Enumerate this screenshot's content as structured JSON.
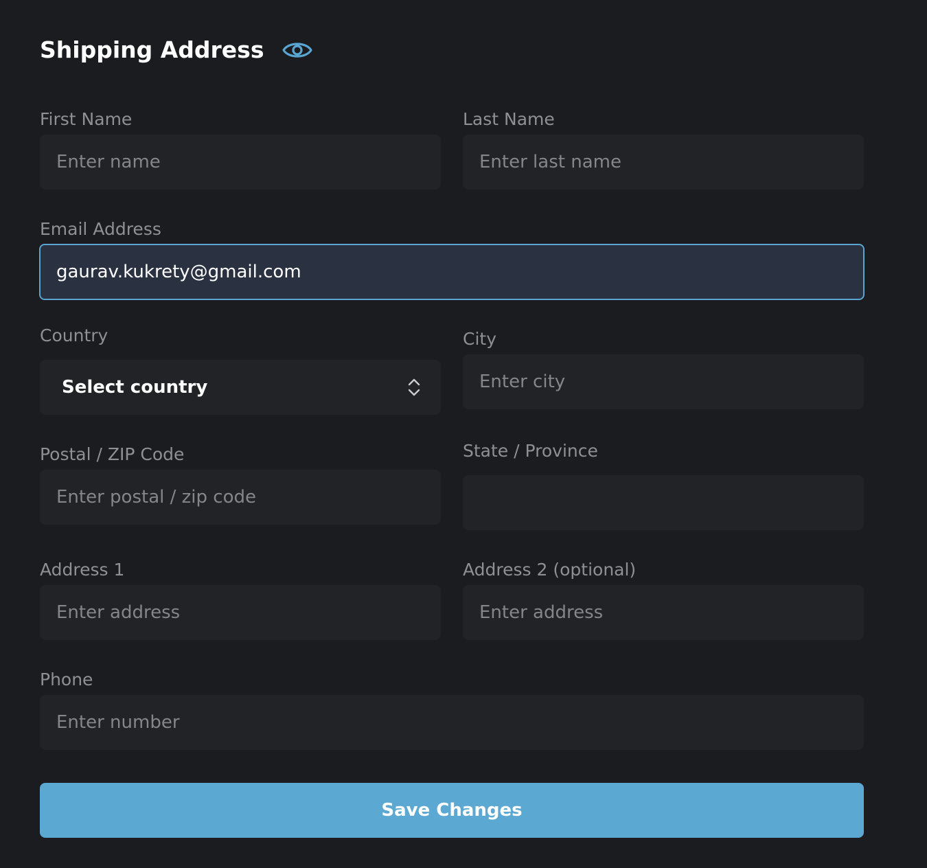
{
  "header": {
    "title": "Shipping Address",
    "visibility_icon": "eye-icon"
  },
  "form": {
    "first_name": {
      "label": "First Name",
      "placeholder": "Enter name",
      "value": ""
    },
    "last_name": {
      "label": "Last Name",
      "placeholder": "Enter last name",
      "value": ""
    },
    "email": {
      "label": "Email Address",
      "placeholder": "",
      "value": "gaurav.kukrety@gmail.com"
    },
    "country": {
      "label": "Country",
      "selected": "Select country",
      "icon": "chevron-up-down-icon"
    },
    "city": {
      "label": "City",
      "placeholder": "Enter city",
      "value": ""
    },
    "postal": {
      "label": "Postal / ZIP Code",
      "placeholder": "Enter postal / zip code",
      "value": ""
    },
    "state": {
      "label": "State / Province",
      "placeholder": "",
      "value": ""
    },
    "address1": {
      "label": "Address 1",
      "placeholder": "Enter address",
      "value": ""
    },
    "address2": {
      "label": "Address 2 (optional)",
      "placeholder": "Enter address",
      "value": ""
    },
    "phone": {
      "label": "Phone",
      "placeholder": "Enter number",
      "value": ""
    }
  },
  "actions": {
    "save_label": "Save Changes"
  },
  "colors": {
    "background": "#1b1c1f",
    "field_background": "#222326",
    "accent": "#5ba8d3",
    "label": "#8e9094",
    "focused_field_background": "#2a3141"
  }
}
